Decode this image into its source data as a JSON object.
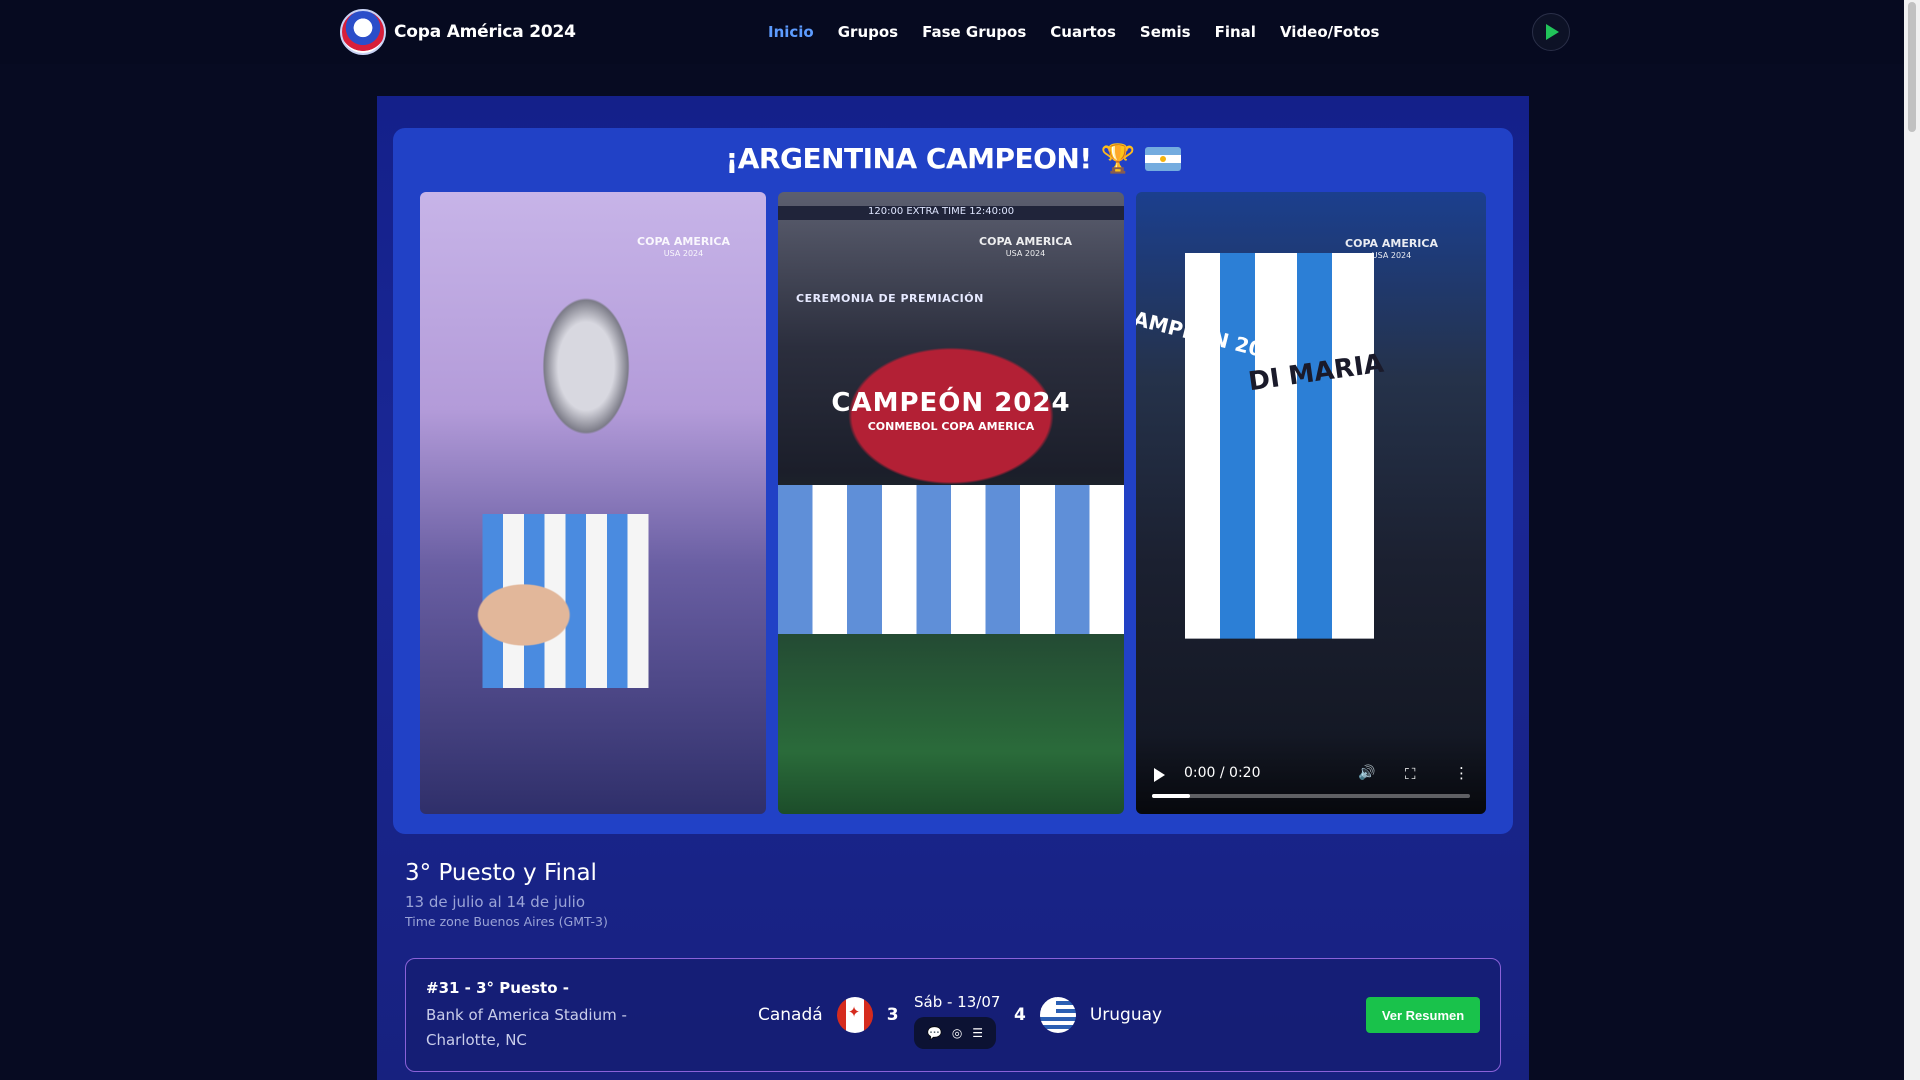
{
  "header": {
    "title": "Copa América 2024",
    "nav": [
      "Inicio",
      "Grupos",
      "Fase Grupos",
      "Cuartos",
      "Semis",
      "Final",
      "Video/Fotos"
    ],
    "active_nav": "Inicio"
  },
  "highlight": {
    "title": "¡ARGENTINA CAMPEON!",
    "trophy_emoji": "🏆",
    "media": [
      {
        "watermark": "COPA AMERICA",
        "watermark_sub": "USA 2024"
      },
      {
        "watermark": "COPA AMERICA",
        "watermark_sub": "USA 2024",
        "banner": "CEREMONIA DE PREMIACIÓN",
        "strip": "120:00   EXTRA TIME   12:40:00",
        "headline": "CAMPEÓN 2024",
        "subheadline": "CONMEBOL COPA AMERICA"
      },
      {
        "watermark": "COPA AMERICA",
        "watermark_sub": "USA 2024",
        "side_text": "AMPEÓN 20",
        "jersey": "DI MARIA",
        "video_time": "0:00 / 0:20",
        "progress_fraction": 0.12
      }
    ]
  },
  "section": {
    "title": "3° Puesto y Final",
    "dates": "13 de julio al 14 de julio",
    "timezone": "Time zone Buenos Aires (GMT-3)"
  },
  "match": {
    "number": "#31 - 3° Puesto -",
    "venue": "Bank of America Stadium - Charlotte, NC",
    "home_team": "Canadá",
    "home_score": "3",
    "date": "Sáb - 13/07",
    "away_score": "4",
    "away_team": "Uruguay",
    "button": "Ver Resumen"
  },
  "colors": {
    "active_nav": "#5d9cff",
    "card_blue": "#2141c6",
    "button_green": "#19c24b",
    "match_border": "#8a62d9"
  }
}
